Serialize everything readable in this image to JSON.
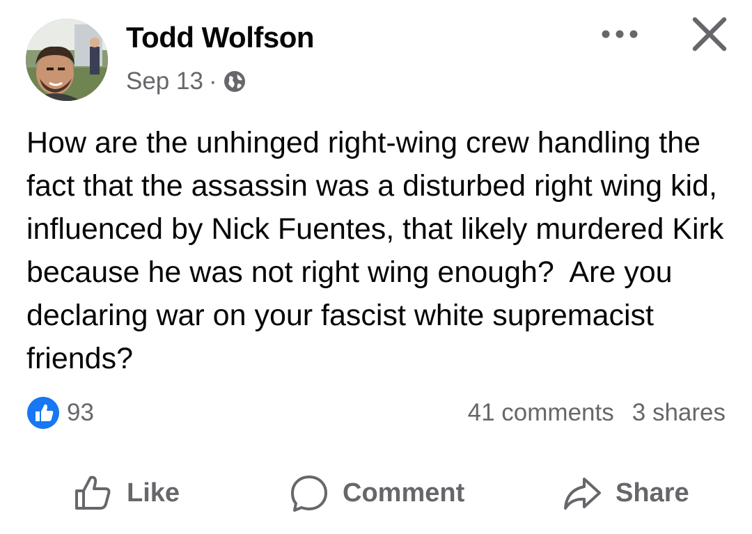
{
  "post": {
    "author": "Todd Wolfson",
    "date": "Sep 13",
    "separator": "·",
    "privacy_icon": "globe-icon",
    "text": "How are the unhinged right-wing crew handling the fact that the assassin was a disturbed right wing kid, influenced by Nick Fuentes, that likely murdered Kirk because he was not right wing enough?  Are you declaring war on your fascist white supremacist friends?"
  },
  "header": {
    "more_icon": "more-options-icon",
    "close_icon": "close-icon"
  },
  "stats": {
    "reaction_icon": "like-reaction-icon",
    "reactions_count": "93",
    "comments": "41 comments",
    "shares": "3 shares"
  },
  "actions": {
    "like_label": "Like",
    "comment_label": "Comment",
    "share_label": "Share"
  },
  "colors": {
    "accent_blue": "#1877f2",
    "text_primary": "#050505",
    "text_secondary": "#65676b"
  }
}
